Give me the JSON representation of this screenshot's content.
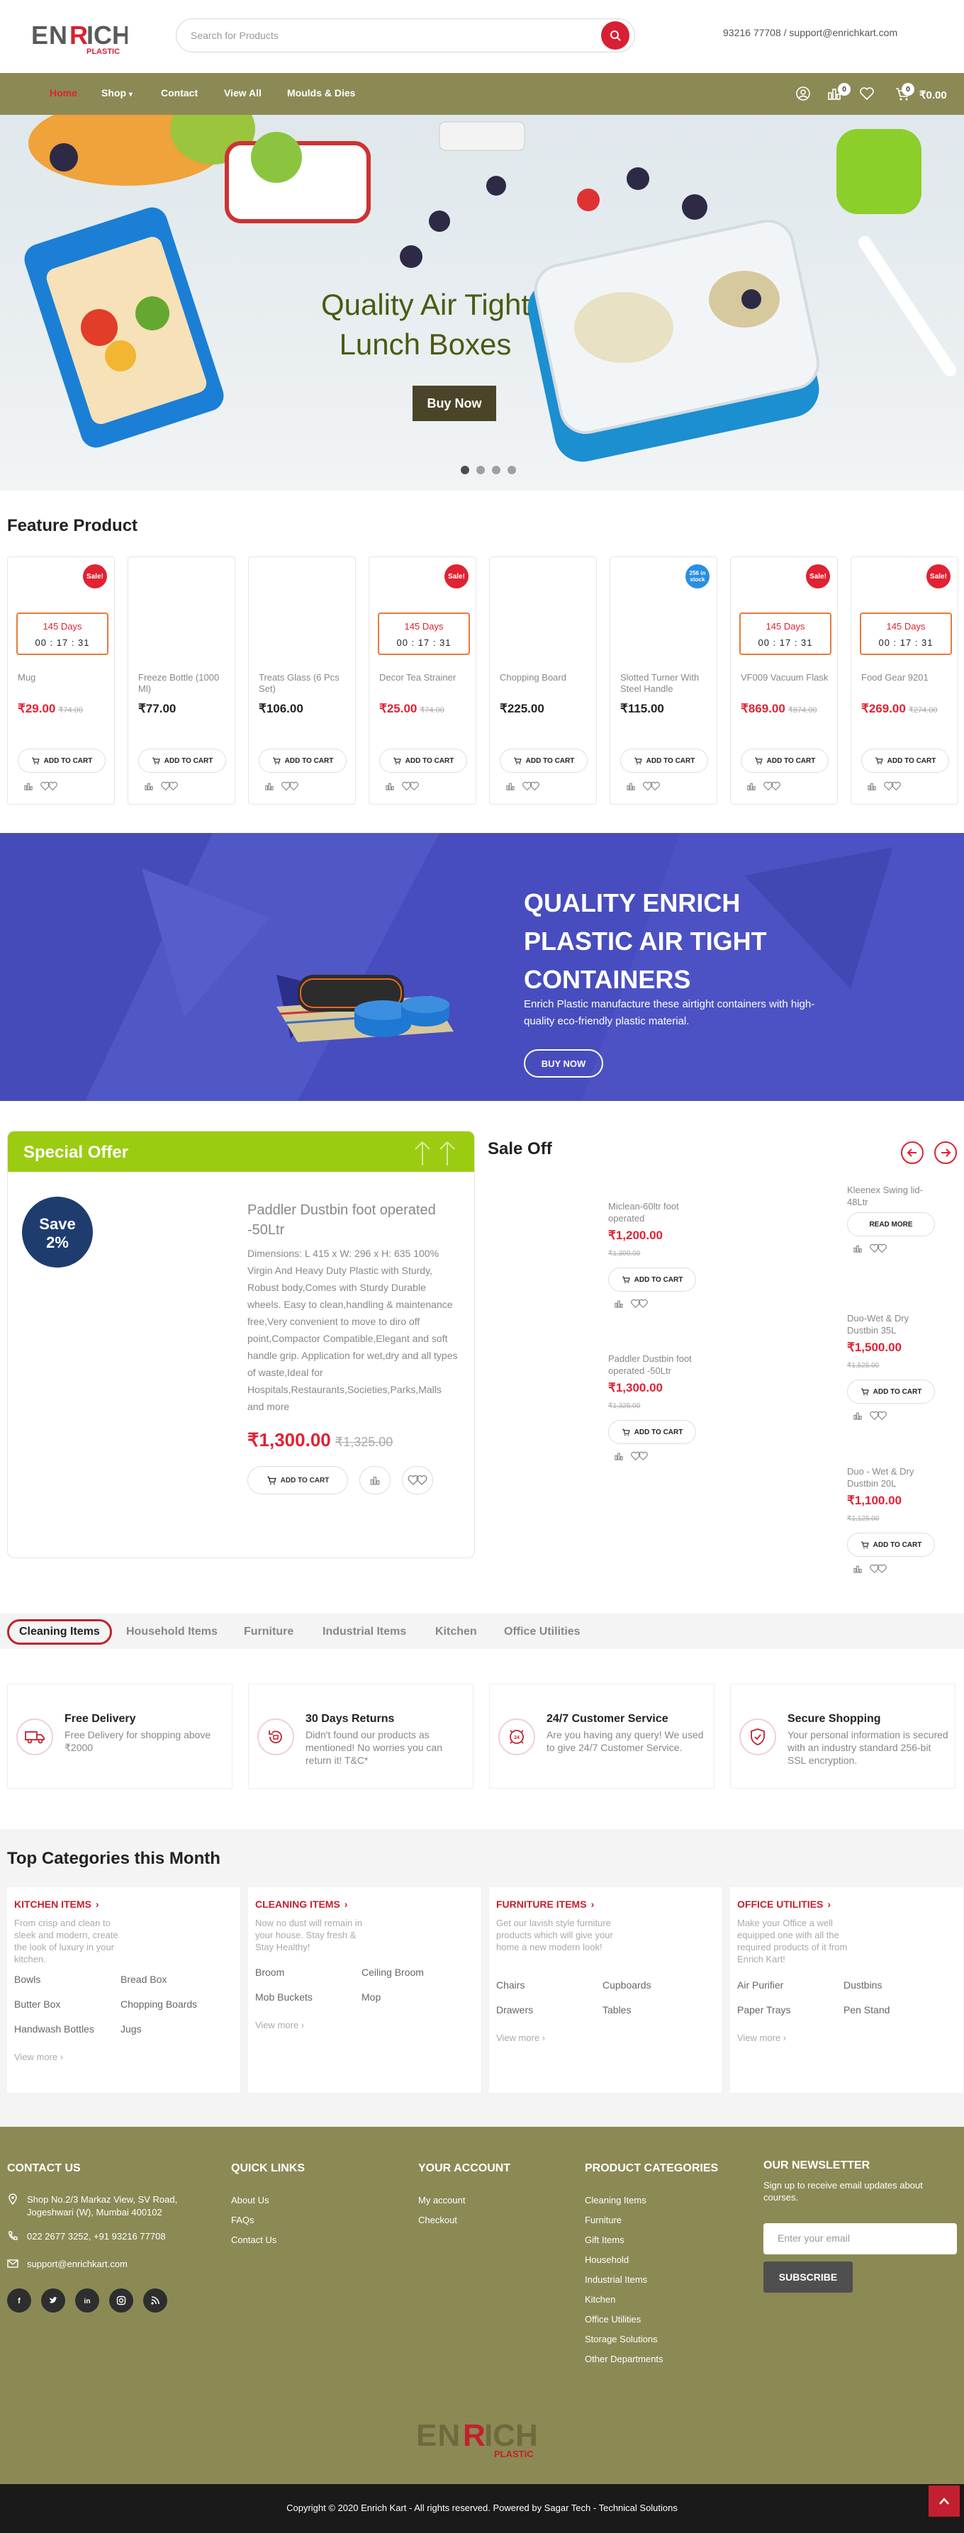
{
  "header": {
    "logo_word": "ENRICH",
    "logo_sub": "PLASTIC",
    "search_placeholder": "Search for Products",
    "contact": "93216 77708 / support@enrichkart.com"
  },
  "nav": {
    "items": [
      "Home",
      "Shop",
      "Contact",
      "View All",
      "Moulds & Dies"
    ],
    "shop_caret": "▾",
    "compare_count": "0",
    "cart_count": "0",
    "cart_total": "₹0.00"
  },
  "hero": {
    "title_line1": "Quality Air Tight",
    "title_line2": "Lunch Boxes",
    "button": "Buy Now",
    "slides": 4,
    "active_slide": 1
  },
  "featured": {
    "title": "Feature Product",
    "products": [
      {
        "name": "Mug",
        "price": "₹29.00",
        "old_price": "₹74.00",
        "badge": "Sale!",
        "days": "145 Days",
        "time": "00 : 17 : 31"
      },
      {
        "name": "Freeze Bottle (1000 Ml)",
        "price": "₹77.00",
        "old_price": "",
        "badge": "",
        "days": "",
        "time": ""
      },
      {
        "name": "Treats Glass (6 Pcs Set)",
        "price": "₹106.00",
        "old_price": "",
        "badge": "",
        "days": "",
        "time": ""
      },
      {
        "name": "Decor Tea Strainer",
        "price": "₹25.00",
        "old_price": "₹74.00",
        "badge": "Sale!",
        "days": "145 Days",
        "time": "00 : 17 : 31"
      },
      {
        "name": "Chopping Board",
        "price": "₹225.00",
        "old_price": "",
        "badge": "",
        "days": "",
        "time": ""
      },
      {
        "name": "Slotted Turner With Steel Handle",
        "price": "₹115.00",
        "old_price": "",
        "badge": "256 in stock",
        "days": "",
        "time": ""
      },
      {
        "name": "VF009 Vacuum Flask",
        "price": "₹869.00",
        "old_price": "₹874.00",
        "badge": "Sale!",
        "days": "145 Days",
        "time": "00 : 17 : 31"
      },
      {
        "name": "Food Gear 9201",
        "price": "₹269.00",
        "old_price": "₹274.00",
        "badge": "Sale!",
        "days": "145 Days",
        "time": "00 : 17 : 31"
      }
    ],
    "add_to_cart": "ADD TO CART"
  },
  "banner": {
    "title": "QUALITY ENRICH PLASTIC AIR TIGHT CONTAINERS",
    "text": "Enrich Plastic manufacture these airtight containers with high-quality eco-friendly plastic material.",
    "button": "BUY NOW"
  },
  "special_offer": {
    "title": "Special Offer",
    "save_label": "Save",
    "save_pct": "2%",
    "product_title": "Paddler Dustbin foot operated -50Ltr",
    "description": "Dimensions: L 415 x W: 296 x H: 635 100% Virgin And Heavy Duty Plastic with Sturdy, Robust body,Comes with Sturdy Durable wheels. Easy to clean,handling & maintenance free,Very convenient to move to diro off point,Compactor Compatible,Elegant and soft handle grip. Application for wet,dry and all types of waste,Ideal for Hospitals,Restaurants,Societies,Parks,Malls and more",
    "price": "₹1,300.00",
    "old_price": "₹1,325.00",
    "add_to_cart": "ADD TO CART"
  },
  "sale_off": {
    "title": "Sale Off",
    "items": [
      {
        "name": "Miclean-60ltr foot operated",
        "price": "₹1,200.00",
        "old_price": "₹1,300.00",
        "button": "ADD TO CART"
      },
      {
        "name": "Paddler Dustbin foot operated -50Ltr",
        "price": "₹1,300.00",
        "old_price": "₹1,325.00",
        "button": "ADD TO CART"
      },
      {
        "name": "Kleenex Swing lid-48Ltr",
        "price": "",
        "old_price": "",
        "button": "READ MORE"
      },
      {
        "name": "Duo-Wet & Dry Dustbin 35L",
        "price": "₹1,500.00",
        "old_price": "₹1,525.00",
        "button": "ADD TO CART"
      },
      {
        "name": "Duo - Wet & Dry Dustbin 20L",
        "price": "₹1,100.00",
        "old_price": "₹1,125.00",
        "button": "ADD TO CART"
      }
    ]
  },
  "tabs": [
    "Cleaning Items",
    "Household Items",
    "Furniture",
    "Industrial Items",
    "Kitchen",
    "Office Utilities"
  ],
  "features": [
    {
      "title": "Free Delivery",
      "desc": "Free Delivery for shopping above ₹2000",
      "icon": "truck-icon"
    },
    {
      "title": "30 Days Returns",
      "desc": "Didn't found our products as mentioned! No worries you can return it! T&C*",
      "icon": "return-icon"
    },
    {
      "title": "24/7 Customer Service",
      "desc": "Are you having any query! We used to give 24/7 Customer Service.",
      "icon": "support-icon"
    },
    {
      "title": "Secure Shopping",
      "desc": "Your personal information is secured with an industry standard 256-bit SSL encryption.",
      "icon": "shield-icon"
    }
  ],
  "categories": {
    "title": "Top Categories this Month",
    "columns": [
      {
        "name": "KITCHEN ITEMS",
        "desc": "From crisp and clean to sleek and modern, create the look of luxury in your kitchen.",
        "links": [
          "Bowls",
          "Bread Box",
          "Butter Box",
          "Chopping Boards",
          "Handwash Bottles",
          "Jugs"
        ]
      },
      {
        "name": "CLEANING ITEMS",
        "desc": "Now no dust will remain in your house. Stay fresh & Stay Healthy!",
        "links": [
          "Broom",
          "Ceiling Broom",
          "Mob Buckets",
          "Mop"
        ]
      },
      {
        "name": "FURNITURE ITEMS",
        "desc": "Get our lavish style furniture products which will give your home a new modern look!",
        "links": [
          "Chairs",
          "Cupboards",
          "Drawers",
          "Tables"
        ]
      },
      {
        "name": "OFFICE UTILITIES",
        "desc": "Make your Office a well equipped one with all the required products of it from Enrich Kart!",
        "links": [
          "Air Purifier",
          "Dustbins",
          "Paper Trays",
          "Pen Stand"
        ]
      }
    ],
    "view_more": "View more ›",
    "chevron": "›"
  },
  "footer": {
    "contact_title": "CONTACT US",
    "address": "Shop No.2/3 Markaz View, SV Road, Jogeshwari (W), Mumbai 400102",
    "phone": "022 2677 3252, +91 93216 77708",
    "email": "support@enrichkart.com",
    "quick_title": "QUICK LINKS",
    "quick_links": [
      "About Us",
      "FAQs",
      "Contact Us"
    ],
    "account_title": "YOUR ACCOUNT",
    "account_links": [
      "My account",
      "Checkout"
    ],
    "cat_title": "PRODUCT CATEGORIES",
    "cat_links": [
      "Cleaning Items",
      "Furniture",
      "Gift Items",
      "Household",
      "Industrial Items",
      "Kitchen",
      "Office Utilities",
      "Storage Solutions",
      "Other Departments"
    ],
    "newsletter_title": "OUR NEWSLETTER",
    "newsletter_text": "Sign up to receive email updates about courses.",
    "email_placeholder": "Enter your email",
    "subscribe": "SUBSCRIBE",
    "copyright": "Copyright © 2020 Enrich Kart - All rights reserved. Powered by Sagar Tech - Technical Solutions"
  },
  "colors": {
    "brand_red": "#d91f33",
    "nav_olive": "#8b8a55",
    "offer_green": "#9ccc11",
    "banner_blue": "#4a50c2"
  }
}
